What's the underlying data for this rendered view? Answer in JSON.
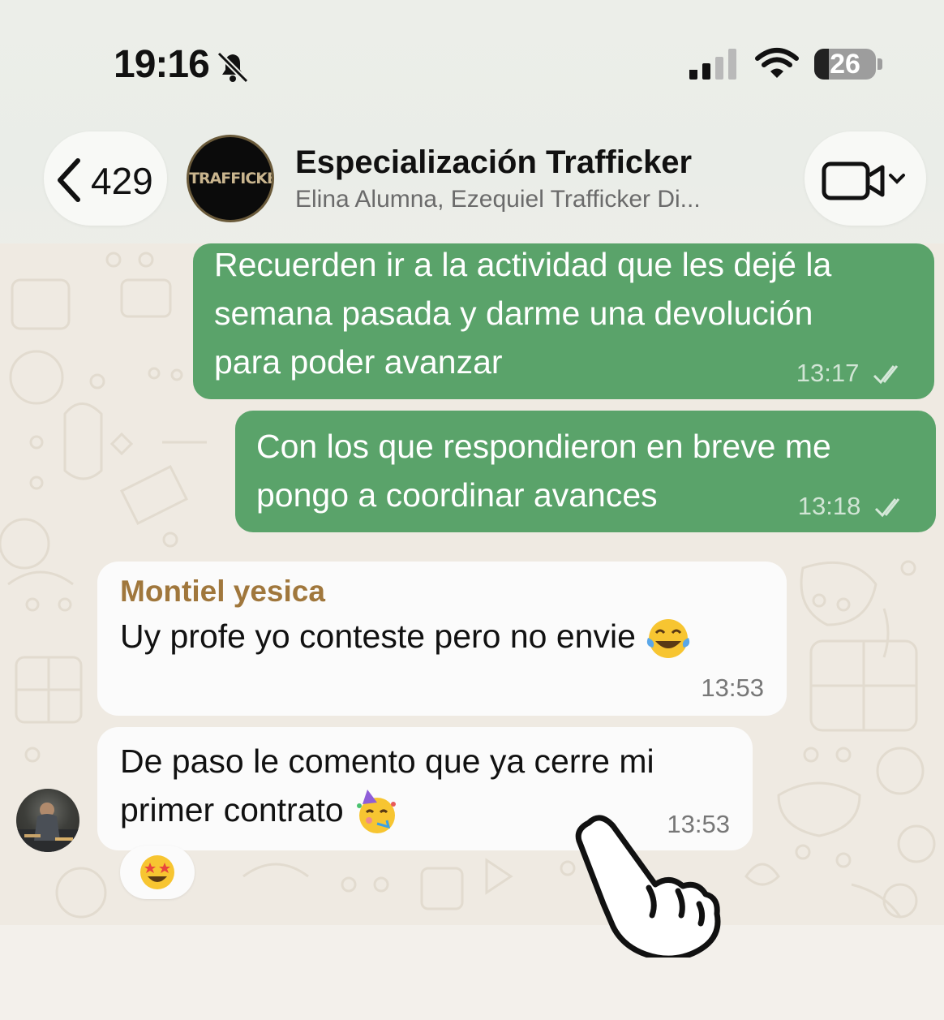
{
  "status_bar": {
    "time": "19:16",
    "battery": "26",
    "icons": [
      "bell-slash-icon",
      "signal-icon",
      "wifi-icon",
      "battery-icon"
    ]
  },
  "header": {
    "back_count": "429",
    "avatar_text": "TRAFFICKER",
    "title": "Especialización Trafficker",
    "subtitle": "Elina Alumna, Ezequiel  Trafficker Di...",
    "icons": [
      "chevron-left-icon",
      "video-camera-icon",
      "chevron-down-icon"
    ]
  },
  "messages": [
    {
      "direction": "outgoing",
      "lines": [
        "Recuerden ir a la actividad que les dejé la",
        "semana pasada y darme una devolución",
        "para poder avanzar"
      ],
      "time": "13:17",
      "status_icon": "double-check-icon"
    },
    {
      "direction": "outgoing",
      "lines": [
        "Con los que respondieron en breve me",
        "pongo a coordinar avances"
      ],
      "time": "13:18",
      "status_icon": "double-check-icon"
    },
    {
      "direction": "incoming",
      "sender": "Montiel yesica",
      "lines": [
        "Uy profe yo conteste pero no envie"
      ],
      "emoji": "tears-of-joy-emoji",
      "time": "13:53"
    },
    {
      "direction": "incoming",
      "lines": [
        "De paso le comento que ya cerre mi",
        "primer contrato"
      ],
      "emoji": "partying-face-emoji",
      "time": "13:53",
      "reaction": "star-struck-emoji"
    }
  ],
  "colors": {
    "outgoing_bubble": "#5aa36a",
    "incoming_bubble": "#fbfbfb",
    "sender_name": "#a0773c",
    "background": "#efeae2"
  }
}
